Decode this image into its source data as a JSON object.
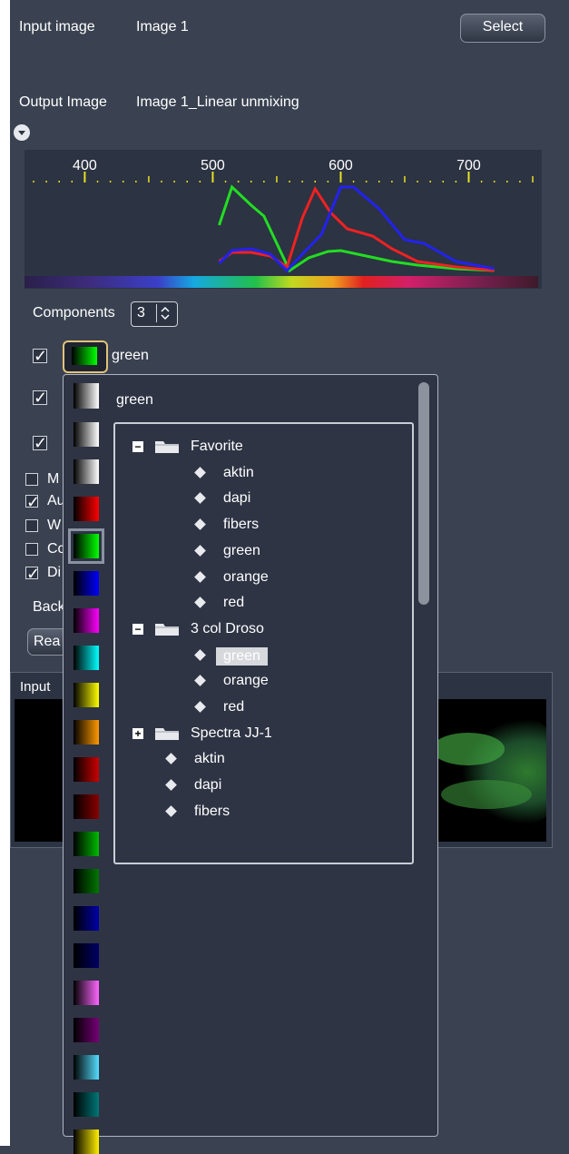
{
  "header": {
    "input_label": "Input image",
    "input_value": "Image 1",
    "select_label": "Select",
    "output_label": "Output Image",
    "output_value": "Image 1_Linear unmixing"
  },
  "chart_data": {
    "type": "line",
    "xlabel": "",
    "ylabel": "",
    "x_ticks": [
      "400",
      "500",
      "600",
      "700"
    ],
    "xlim": [
      360,
      750
    ],
    "series": [
      {
        "color": "#22dd22",
        "x": [
          505,
          515,
          530,
          540,
          550,
          560,
          575,
          590,
          600,
          620,
          640,
          660,
          690,
          720
        ],
        "y": [
          0.52,
          0.94,
          0.74,
          0.62,
          0.32,
          0.02,
          0.16,
          0.23,
          0.24,
          0.18,
          0.12,
          0.08,
          0.04,
          0.02
        ]
      },
      {
        "color": "#ee2222",
        "x": [
          505,
          515,
          530,
          545,
          558,
          570,
          580,
          592,
          605,
          625,
          640,
          660,
          690,
          720
        ],
        "y": [
          0.12,
          0.22,
          0.22,
          0.18,
          0.06,
          0.6,
          0.92,
          0.66,
          0.48,
          0.4,
          0.26,
          0.12,
          0.06,
          0.02
        ]
      },
      {
        "color": "#2222ee",
        "x": [
          505,
          515,
          530,
          545,
          558,
          570,
          585,
          600,
          610,
          630,
          650,
          665,
          690,
          720
        ],
        "y": [
          0.1,
          0.24,
          0.26,
          0.2,
          0.02,
          0.2,
          0.42,
          0.94,
          0.94,
          0.7,
          0.36,
          0.32,
          0.12,
          0.04
        ]
      }
    ]
  },
  "controls": {
    "components_label": "Components",
    "components_value": "3",
    "channel_name": "green",
    "truncated_labels": [
      "M",
      "Au",
      "W",
      "Co",
      "Di"
    ],
    "back_label": "Back",
    "rea_label": "Rea",
    "input_tab": "Input"
  },
  "popup": {
    "title": "green",
    "tree": [
      {
        "folder": "Favorite",
        "expanded": true,
        "items": [
          "aktin",
          "dapi",
          "fibers",
          "green",
          "orange",
          "red"
        ]
      },
      {
        "folder": "3 col Droso",
        "expanded": true,
        "items": [
          "green",
          "orange",
          "red"
        ],
        "selected": "green"
      },
      {
        "folder": "Spectra JJ-1",
        "expanded": false,
        "items": [
          "aktin",
          "dapi",
          "fibers"
        ]
      }
    ],
    "swatches": [
      {
        "color": "#ffffff"
      },
      {
        "color": "#ffffff"
      },
      {
        "color": "#ff0000"
      },
      {
        "color": "#00ff00"
      },
      {
        "color": "#0000ff"
      },
      {
        "color": "#ff00ff"
      },
      {
        "color": "#00ffff"
      },
      {
        "color": "#ffff00"
      },
      {
        "color": "#ff9900"
      },
      {
        "color": "#cc0000"
      },
      {
        "color": "#880000"
      },
      {
        "color": "#00bb00"
      },
      {
        "color": "#007700"
      },
      {
        "color": "#0000aa"
      },
      {
        "color": "#000066"
      },
      {
        "color": "#ff66ff"
      },
      {
        "color": "#770077"
      },
      {
        "color": "#55ddff"
      },
      {
        "color": "#007777"
      },
      {
        "color": "#ffee00"
      }
    ]
  }
}
